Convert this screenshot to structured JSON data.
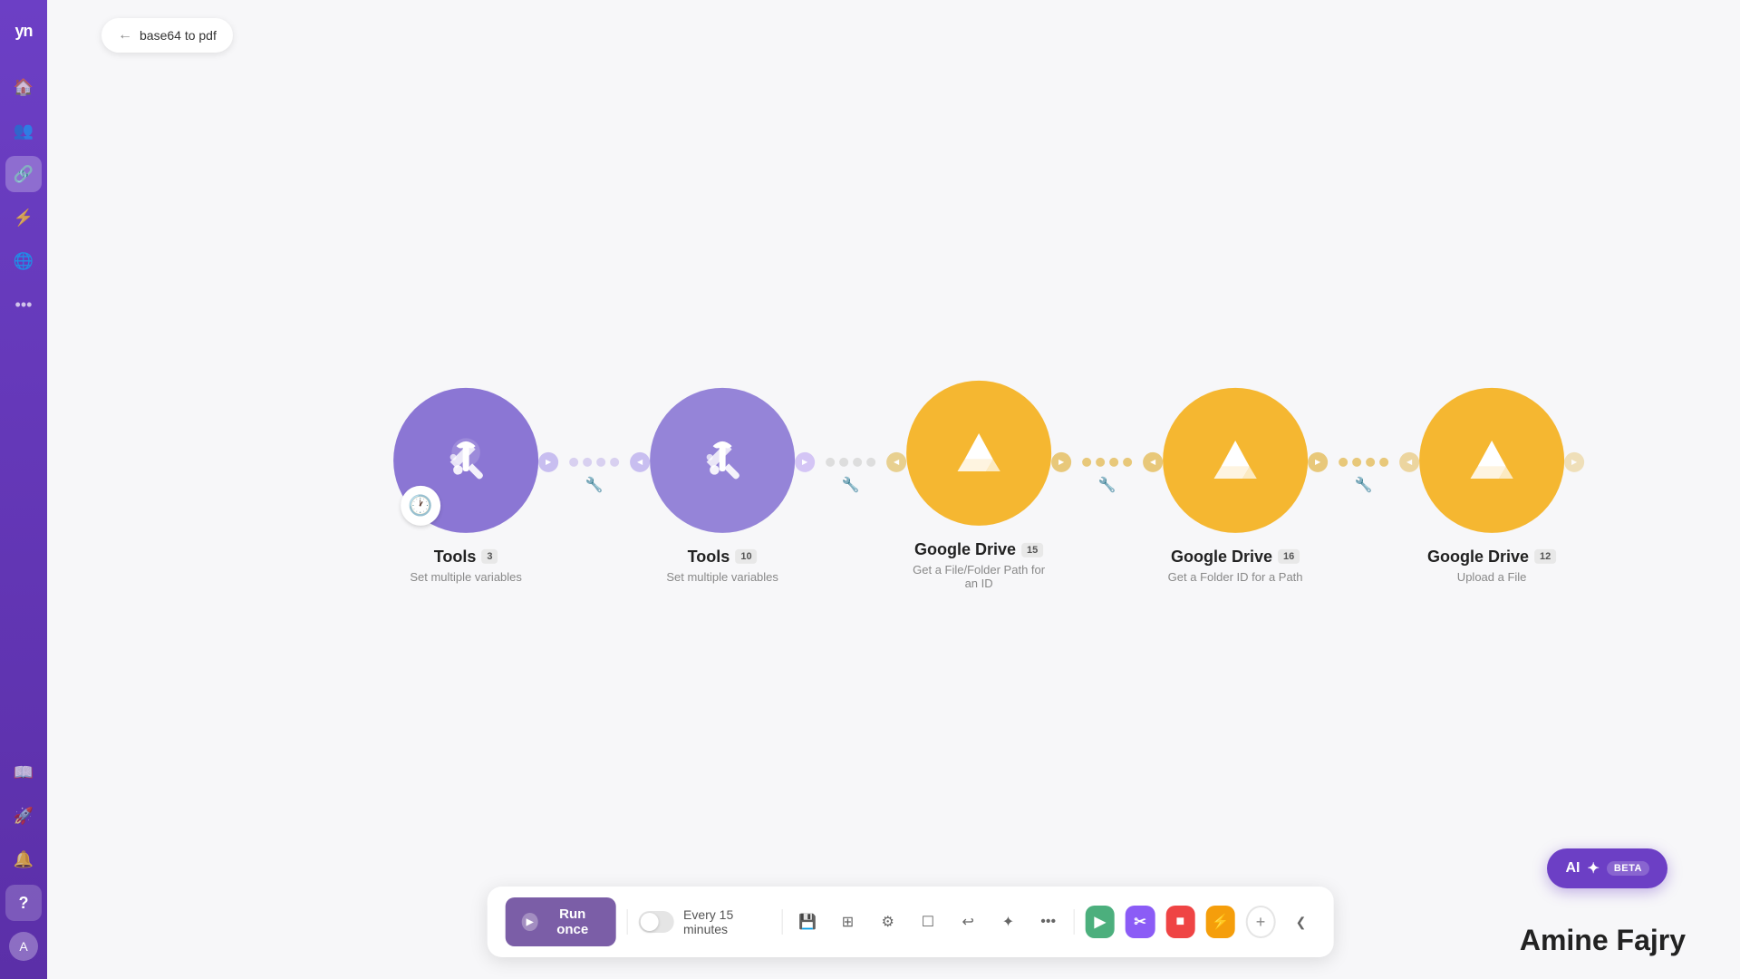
{
  "app": {
    "logo": "yn",
    "breadcrumb": {
      "back_label": "←",
      "title": "base64 to pdf"
    }
  },
  "sidebar": {
    "items": [
      {
        "icon": "🏠",
        "label": "Home",
        "active": false
      },
      {
        "icon": "👥",
        "label": "Team",
        "active": false
      },
      {
        "icon": "🔗",
        "label": "Connections",
        "active": true
      },
      {
        "icon": "⚡",
        "label": "Automations",
        "active": false
      },
      {
        "icon": "🌐",
        "label": "Global",
        "active": false
      },
      {
        "icon": "⋯",
        "label": "More",
        "active": false
      }
    ],
    "bottom_items": [
      {
        "icon": "📖",
        "label": "Docs"
      },
      {
        "icon": "🚀",
        "label": "Deploy"
      },
      {
        "icon": "🔔",
        "label": "Notifications"
      },
      {
        "icon": "?",
        "label": "Help"
      },
      {
        "icon": "👤",
        "label": "Profile"
      }
    ]
  },
  "workflow": {
    "nodes": [
      {
        "id": "tools-1",
        "type": "tools",
        "title": "Tools",
        "badge": "3",
        "subtitle": "Set multiple variables",
        "color": "purple",
        "has_clock": true
      },
      {
        "id": "tools-2",
        "type": "tools",
        "title": "Tools",
        "badge": "10",
        "subtitle": "Set multiple variables",
        "color": "purple-light",
        "has_clock": false
      },
      {
        "id": "gdrive-1",
        "type": "google-drive",
        "title": "Google Drive",
        "badge": "15",
        "subtitle": "Get a File/Folder Path for an ID",
        "color": "gold",
        "has_clock": false
      },
      {
        "id": "gdrive-2",
        "type": "google-drive",
        "title": "Google Drive",
        "badge": "16",
        "subtitle": "Get a Folder ID for a Path",
        "color": "gold",
        "has_clock": false
      },
      {
        "id": "gdrive-3",
        "type": "google-drive",
        "title": "Google Drive",
        "badge": "12",
        "subtitle": "Upload a File",
        "color": "gold",
        "has_clock": false
      }
    ]
  },
  "toolbar": {
    "run_once_label": "Run once",
    "schedule_label": "Every 15 minutes",
    "buttons": {
      "save": "💾",
      "module": "⊞",
      "settings": "⚙",
      "notes": "☐",
      "undo": "↩",
      "magic": "✦",
      "more": "⋯"
    },
    "colored_buttons": [
      {
        "color": "green",
        "icon": "▶"
      },
      {
        "color": "purple",
        "icon": "✂"
      },
      {
        "color": "red",
        "icon": "■"
      },
      {
        "color": "orange",
        "icon": "⚡"
      }
    ],
    "add_label": "+",
    "collapse_label": "❮"
  },
  "ai_button": {
    "label": "AI",
    "beta_label": "BETA"
  },
  "watermark": {
    "text": "Amine Fajry"
  }
}
